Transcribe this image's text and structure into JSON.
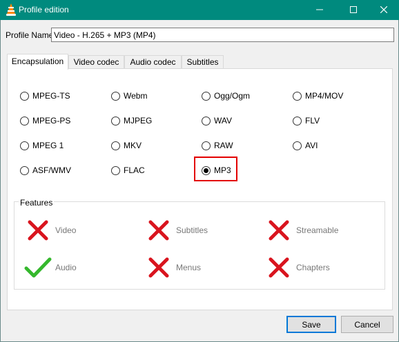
{
  "window": {
    "title": "Profile edition",
    "app_icon": "vlc-cone-icon",
    "controls": [
      "minimize-icon",
      "maximize-icon",
      "close-icon"
    ]
  },
  "profile_name": {
    "label": "Profile Name",
    "value": "Video - H.265 + MP3 (MP4)"
  },
  "tabs": [
    {
      "label": "Encapsulation",
      "active": true
    },
    {
      "label": "Video codec",
      "active": false
    },
    {
      "label": "Audio codec",
      "active": false
    },
    {
      "label": "Subtitles",
      "active": false
    }
  ],
  "encapsulation": {
    "options": [
      {
        "label": "MPEG-TS",
        "checked": false
      },
      {
        "label": "Webm",
        "checked": false
      },
      {
        "label": "Ogg/Ogm",
        "checked": false
      },
      {
        "label": "MP4/MOV",
        "checked": false
      },
      {
        "label": "MPEG-PS",
        "checked": false
      },
      {
        "label": "MJPEG",
        "checked": false
      },
      {
        "label": "WAV",
        "checked": false
      },
      {
        "label": "FLV",
        "checked": false
      },
      {
        "label": "MPEG 1",
        "checked": false
      },
      {
        "label": "MKV",
        "checked": false
      },
      {
        "label": "RAW",
        "checked": false
      },
      {
        "label": "AVI",
        "checked": false
      },
      {
        "label": "ASF/WMV",
        "checked": false
      },
      {
        "label": "FLAC",
        "checked": false
      },
      {
        "label": "MP3",
        "checked": true
      }
    ],
    "highlight_color": "#e30000"
  },
  "features": {
    "title": "Features",
    "items": [
      {
        "label": "Video",
        "supported": false
      },
      {
        "label": "Subtitles",
        "supported": false
      },
      {
        "label": "Streamable",
        "supported": false
      },
      {
        "label": "Audio",
        "supported": true
      },
      {
        "label": "Menus",
        "supported": false
      },
      {
        "label": "Chapters",
        "supported": false
      }
    ],
    "colors": {
      "no": "#d9141e",
      "yes": "#35b82d"
    }
  },
  "buttons": {
    "save": "Save",
    "cancel": "Cancel"
  },
  "colors": {
    "titlebar": "#008a7e",
    "focus_border": "#0078d7"
  }
}
